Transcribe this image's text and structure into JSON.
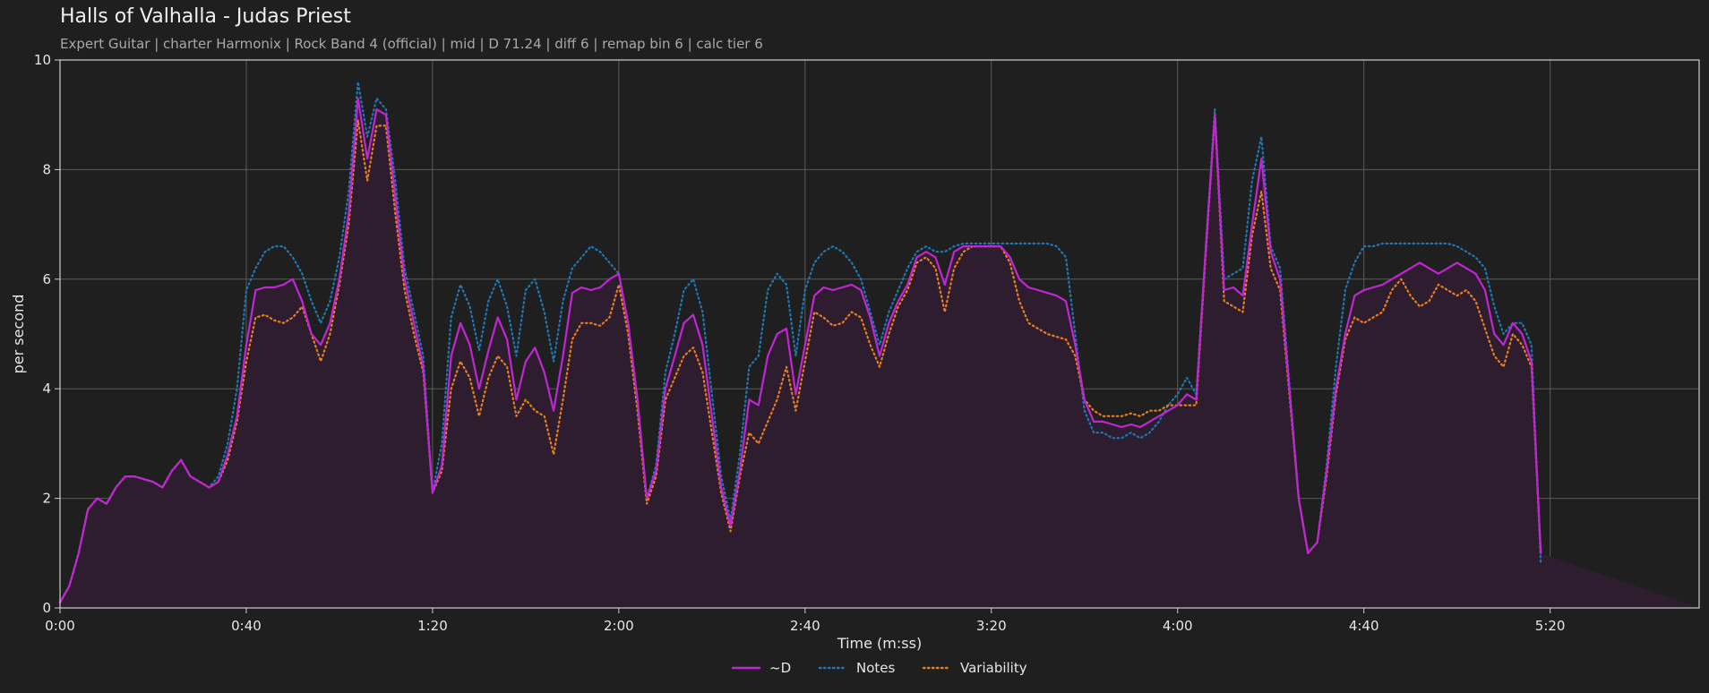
{
  "header": {
    "title": "Halls of Valhalla - Judas Priest",
    "subtitle": "Expert Guitar  |  charter Harmonix  |  Rock Band 4 (official)  |  mid  |  D 71.24  |  diff 6  |  remap bin 6  |  calc tier 6"
  },
  "colors": {
    "background": "#1f1f1f",
    "plot_background": "#1f1f1f",
    "grid": "#5a5a5a",
    "axis": "#cfcfcf",
    "d": "#c026d3",
    "notes": "#1f77b4",
    "variability": "#e67e22",
    "fill": "#2e1d2e"
  },
  "chart_data": {
    "type": "line",
    "title": "Halls of Valhalla - Judas Priest",
    "xlabel": "Time (m:ss)",
    "ylabel": "per second",
    "xlim": [
      0,
      352
    ],
    "ylim": [
      0,
      10
    ],
    "grid": true,
    "legend_position": "bottom-center",
    "x_ticks": [
      {
        "value": 0,
        "label": "0:00"
      },
      {
        "value": 40,
        "label": "0:40"
      },
      {
        "value": 80,
        "label": "1:20"
      },
      {
        "value": 120,
        "label": "2:00"
      },
      {
        "value": 160,
        "label": "2:40"
      },
      {
        "value": 200,
        "label": "3:20"
      },
      {
        "value": 240,
        "label": "4:00"
      },
      {
        "value": 280,
        "label": "4:40"
      },
      {
        "value": 320,
        "label": "5:20"
      }
    ],
    "y_ticks": [
      {
        "value": 0,
        "label": "0"
      },
      {
        "value": 2,
        "label": "2"
      },
      {
        "value": 4,
        "label": "4"
      },
      {
        "value": 6,
        "label": "6"
      },
      {
        "value": 8,
        "label": "8"
      },
      {
        "value": 10,
        "label": "10"
      }
    ],
    "x": [
      0,
      2,
      4,
      6,
      8,
      10,
      12,
      14,
      16,
      18,
      20,
      22,
      24,
      26,
      28,
      30,
      32,
      34,
      36,
      38,
      40,
      42,
      44,
      46,
      48,
      50,
      52,
      54,
      56,
      58,
      60,
      62,
      64,
      66,
      68,
      70,
      72,
      74,
      76,
      78,
      80,
      82,
      84,
      86,
      88,
      90,
      92,
      94,
      96,
      98,
      100,
      102,
      104,
      106,
      108,
      110,
      112,
      114,
      116,
      118,
      120,
      122,
      124,
      126,
      128,
      130,
      132,
      134,
      136,
      138,
      140,
      142,
      144,
      146,
      148,
      150,
      152,
      154,
      156,
      158,
      160,
      162,
      164,
      166,
      168,
      170,
      172,
      174,
      176,
      178,
      180,
      182,
      184,
      186,
      188,
      190,
      192,
      194,
      196,
      198,
      200,
      202,
      204,
      206,
      208,
      210,
      212,
      214,
      216,
      218,
      220,
      222,
      224,
      226,
      228,
      230,
      232,
      234,
      236,
      238,
      240,
      242,
      244,
      246,
      248,
      250,
      252,
      254,
      256,
      258,
      260,
      262,
      264,
      266,
      268,
      270,
      272,
      274,
      276,
      278,
      280,
      282,
      284,
      286,
      288,
      290,
      292,
      294,
      296,
      298,
      300,
      302,
      304,
      306,
      308,
      310,
      312,
      314,
      316,
      318,
      320,
      322,
      324,
      326,
      328,
      330,
      332,
      334,
      336,
      338,
      340,
      342,
      344,
      346,
      348,
      350,
      352
    ],
    "series": [
      {
        "name": "~D",
        "style": "solid",
        "color": "#c026d3",
        "fill": true,
        "values": [
          0.1,
          0.4,
          1.0,
          1.8,
          2.0,
          1.9,
          2.2,
          2.4,
          2.4,
          2.35,
          2.3,
          2.2,
          2.5,
          2.7,
          2.4,
          2.3,
          2.2,
          2.3,
          2.8,
          3.5,
          4.8,
          5.8,
          5.85,
          5.85,
          5.9,
          6.0,
          5.6,
          5.0,
          4.8,
          5.2,
          6.0,
          7.2,
          9.3,
          8.2,
          9.1,
          9.0,
          7.5,
          6.0,
          5.2,
          4.4,
          2.1,
          2.6,
          4.6,
          5.2,
          4.8,
          4.0,
          4.7,
          5.3,
          4.9,
          3.8,
          4.5,
          4.75,
          4.3,
          3.6,
          4.6,
          5.75,
          5.85,
          5.8,
          5.85,
          6.0,
          6.1,
          5.2,
          3.8,
          2.0,
          2.5,
          4.0,
          4.6,
          5.2,
          5.35,
          4.8,
          3.5,
          2.2,
          1.5,
          2.5,
          3.8,
          3.7,
          4.6,
          5.0,
          5.1,
          3.9,
          4.8,
          5.7,
          5.85,
          5.8,
          5.85,
          5.9,
          5.8,
          5.3,
          4.6,
          5.2,
          5.6,
          5.9,
          6.4,
          6.5,
          6.4,
          5.9,
          6.5,
          6.6,
          6.6,
          6.6,
          6.6,
          6.6,
          6.4,
          6.0,
          5.85,
          5.8,
          5.75,
          5.7,
          5.6,
          4.8,
          3.8,
          3.4,
          3.4,
          3.35,
          3.3,
          3.35,
          3.3,
          3.4,
          3.5,
          3.6,
          3.7,
          3.9,
          3.8,
          6.5,
          9.0,
          5.8,
          5.85,
          5.7,
          7.0,
          8.2,
          6.5,
          6.0,
          4.0,
          2.0,
          1.0,
          1.2,
          2.5,
          4.0,
          5.0,
          5.7,
          5.8,
          5.85,
          5.9,
          6.0,
          6.1,
          6.2,
          6.3,
          6.2,
          6.1,
          6.2,
          6.3,
          6.2,
          6.1,
          5.8,
          5.0,
          4.8,
          5.2,
          5.0,
          4.5,
          1.0
        ]
      },
      {
        "name": "Notes",
        "style": "dotted",
        "color": "#1f77b4",
        "fill": false,
        "values": [
          0.1,
          0.4,
          1.0,
          1.8,
          2.0,
          1.9,
          2.2,
          2.4,
          2.4,
          2.35,
          2.3,
          2.2,
          2.5,
          2.7,
          2.4,
          2.3,
          2.2,
          2.4,
          3.0,
          4.0,
          5.8,
          6.2,
          6.5,
          6.6,
          6.6,
          6.4,
          6.1,
          5.6,
          5.2,
          5.6,
          6.4,
          7.6,
          9.6,
          8.6,
          9.3,
          9.1,
          7.8,
          6.2,
          5.4,
          4.6,
          2.1,
          3.0,
          5.3,
          5.9,
          5.5,
          4.7,
          5.6,
          6.0,
          5.5,
          4.6,
          5.8,
          6.0,
          5.4,
          4.5,
          5.6,
          6.2,
          6.4,
          6.6,
          6.5,
          6.3,
          6.1,
          5.2,
          3.8,
          2.0,
          2.6,
          4.3,
          5.0,
          5.8,
          6.0,
          5.4,
          3.9,
          2.4,
          1.6,
          2.8,
          4.4,
          4.6,
          5.8,
          6.1,
          5.9,
          4.6,
          5.8,
          6.3,
          6.5,
          6.6,
          6.5,
          6.3,
          6.0,
          5.4,
          4.8,
          5.4,
          5.8,
          6.2,
          6.5,
          6.6,
          6.5,
          6.5,
          6.6,
          6.65,
          6.65,
          6.65,
          6.65,
          6.65,
          6.65,
          6.65,
          6.65,
          6.65,
          6.65,
          6.6,
          6.4,
          5.0,
          3.6,
          3.2,
          3.2,
          3.1,
          3.1,
          3.2,
          3.1,
          3.2,
          3.4,
          3.7,
          3.9,
          4.2,
          3.9,
          6.5,
          9.1,
          6.0,
          6.1,
          6.2,
          7.8,
          8.6,
          6.6,
          6.2,
          4.1,
          2.0,
          1.0,
          1.2,
          2.6,
          4.4,
          5.8,
          6.3,
          6.6,
          6.6,
          6.65,
          6.65,
          6.65,
          6.65,
          6.65,
          6.65,
          6.65,
          6.65,
          6.6,
          6.5,
          6.4,
          6.2,
          5.5,
          5.0,
          5.2,
          5.2,
          4.8,
          0.8
        ]
      },
      {
        "name": "Variability",
        "style": "dotted",
        "color": "#e67e22",
        "fill": false,
        "values": [
          0.1,
          0.4,
          1.0,
          1.8,
          2.0,
          1.9,
          2.2,
          2.4,
          2.4,
          2.35,
          2.3,
          2.2,
          2.5,
          2.7,
          2.4,
          2.3,
          2.2,
          2.3,
          2.7,
          3.4,
          4.5,
          5.3,
          5.35,
          5.25,
          5.2,
          5.3,
          5.5,
          5.0,
          4.5,
          5.0,
          5.9,
          7.0,
          8.9,
          7.8,
          8.8,
          8.8,
          7.2,
          5.8,
          5.0,
          4.3,
          2.1,
          2.5,
          4.0,
          4.5,
          4.2,
          3.5,
          4.2,
          4.6,
          4.4,
          3.5,
          3.8,
          3.6,
          3.5,
          2.8,
          3.8,
          4.9,
          5.2,
          5.2,
          5.15,
          5.3,
          5.9,
          5.0,
          3.6,
          1.9,
          2.4,
          3.8,
          4.2,
          4.6,
          4.75,
          4.3,
          3.2,
          2.1,
          1.4,
          2.4,
          3.2,
          3.0,
          3.4,
          3.8,
          4.4,
          3.6,
          4.5,
          5.4,
          5.3,
          5.15,
          5.2,
          5.4,
          5.3,
          4.8,
          4.4,
          5.0,
          5.5,
          5.8,
          6.3,
          6.4,
          6.2,
          5.4,
          6.2,
          6.5,
          6.6,
          6.6,
          6.6,
          6.6,
          6.3,
          5.6,
          5.2,
          5.1,
          5.0,
          4.95,
          4.9,
          4.6,
          3.8,
          3.6,
          3.5,
          3.5,
          3.5,
          3.55,
          3.5,
          3.6,
          3.6,
          3.7,
          3.7,
          3.7,
          3.7,
          6.4,
          9.0,
          5.6,
          5.5,
          5.4,
          6.8,
          7.6,
          6.2,
          5.8,
          3.9,
          2.0,
          1.0,
          1.2,
          2.4,
          3.9,
          4.9,
          5.3,
          5.2,
          5.3,
          5.4,
          5.8,
          6.0,
          5.7,
          5.5,
          5.6,
          5.9,
          5.8,
          5.7,
          5.8,
          5.6,
          5.1,
          4.6,
          4.4,
          5.0,
          4.8,
          4.4,
          1.0
        ]
      }
    ]
  }
}
